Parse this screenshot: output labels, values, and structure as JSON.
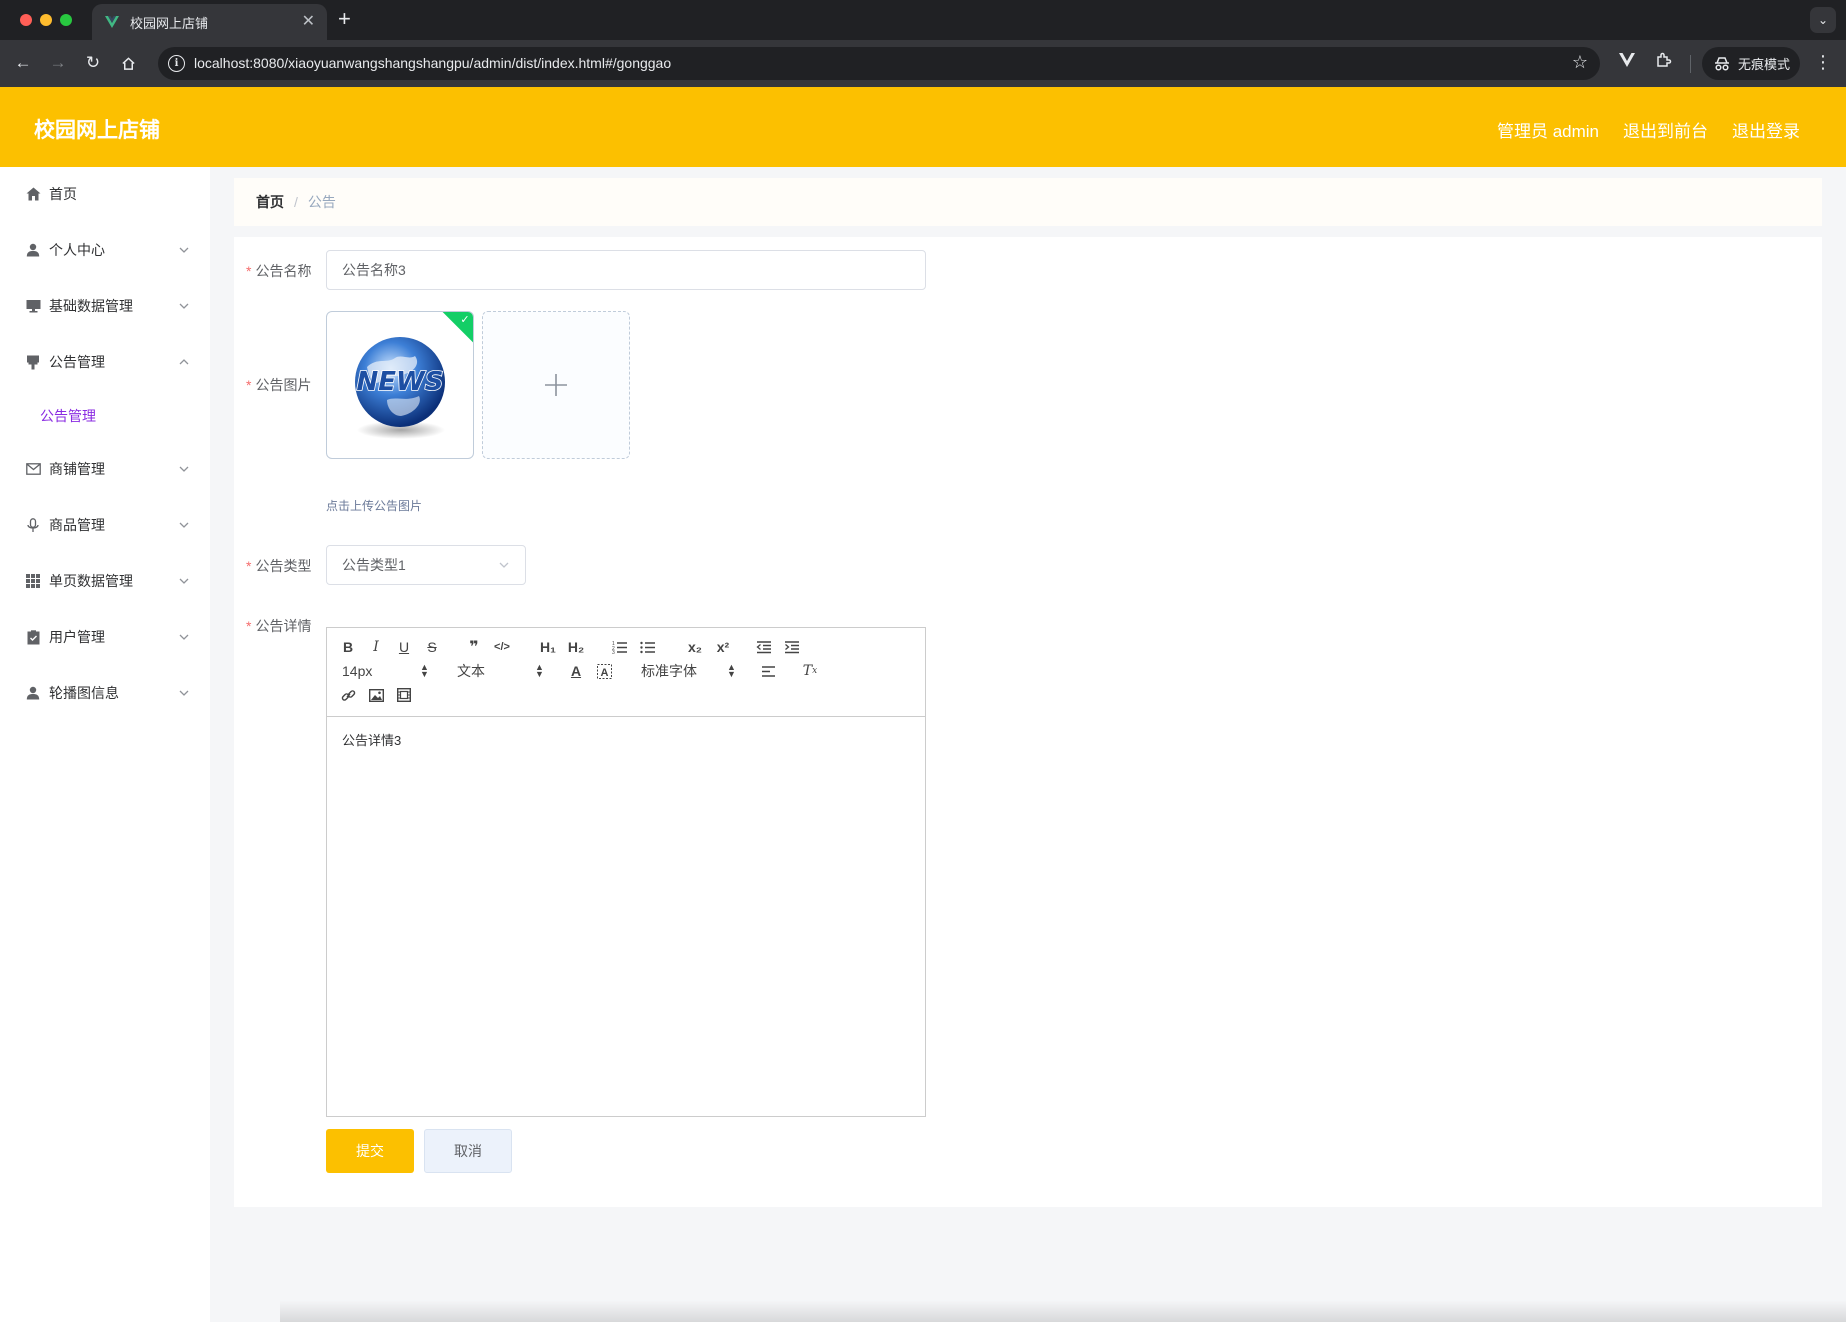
{
  "browser": {
    "tab_title": "校园网上店铺",
    "new_tab": "+",
    "url": "localhost:8080/xiaoyuanwangshangshangpu/admin/dist/index.html#/gonggao",
    "incognito_label": "无痕模式"
  },
  "header": {
    "title": "校园网上店铺",
    "user_label": "管理员 admin",
    "front_link": "退出到前台",
    "logout_link": "退出登录",
    "color": "#fcc000"
  },
  "sidebar": {
    "items": [
      {
        "label": "首页",
        "icon": "home-icon"
      },
      {
        "label": "个人中心",
        "icon": "user-icon"
      },
      {
        "label": "基础数据管理",
        "icon": "monitor-icon"
      },
      {
        "label": "公告管理",
        "icon": "brush-icon",
        "expanded": true
      },
      {
        "label": "商铺管理",
        "icon": "mail-icon"
      },
      {
        "label": "商品管理",
        "icon": "microphone-icon"
      },
      {
        "label": "单页数据管理",
        "icon": "grid-icon"
      },
      {
        "label": "用户管理",
        "icon": "clipboard-icon"
      },
      {
        "label": "轮播图信息",
        "icon": "user-icon"
      }
    ],
    "submenu": {
      "label": "公告管理",
      "color": "#8a2be2"
    }
  },
  "breadcrumb": {
    "home": "首页",
    "separator": "/",
    "current": "公告"
  },
  "form": {
    "name": {
      "label": "公告名称",
      "value": "公告名称3"
    },
    "image": {
      "label": "公告图片",
      "tip": "点击上传公告图片",
      "thumb_text": "NEWS"
    },
    "type": {
      "label": "公告类型",
      "value": "公告类型1"
    },
    "detail": {
      "label": "公告详情",
      "content": "公告详情3",
      "toolbar": {
        "size": "14px",
        "header": "文本",
        "font": "标准字体",
        "h1": "H₁",
        "h2": "H₂",
        "sub": "x₂",
        "sup": "x²"
      }
    },
    "submit_label": "提交",
    "cancel_label": "取消",
    "required_mark": "*"
  }
}
